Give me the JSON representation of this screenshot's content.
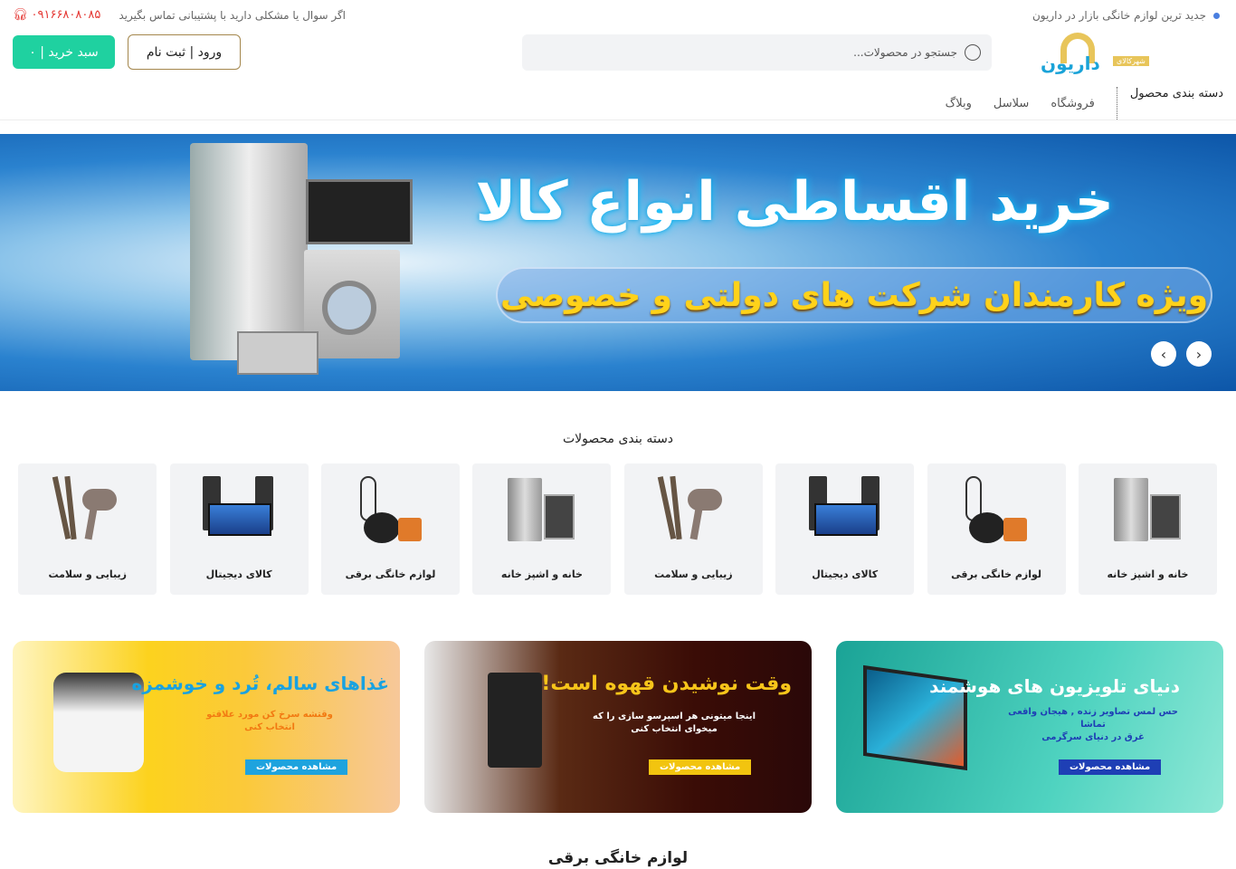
{
  "topbar": {
    "announcement": "جدید ترین لوازم خانگی بازار در داریون",
    "support_text": "اگر سوال یا مشکلی دارید با پشتیبانی تماس بگیرید",
    "phone": "۰۹۱۶۶۸۰۸۰۸۵",
    "dot_color": "#4a7fe0"
  },
  "header": {
    "logo_text": "داریون",
    "logo_tag": "شهرکالای",
    "search_placeholder": "جستجو در محصولات...",
    "login_label": "ورود | ثبت نام",
    "cart_label": "سبد خرید | ۰",
    "cart_color": "#1fd1a0"
  },
  "nav": {
    "items": [
      "دسته بندی محصول",
      "فروشگاه",
      "سلاسل",
      "وبلاگ"
    ]
  },
  "banner": {
    "title": "خرید اقساطی انواع کالا",
    "subtitle": "ویژه کارمندان شرکت های دولتی و خصوصی"
  },
  "categories": {
    "title": "دسته بندی محصولات",
    "items": [
      {
        "label": "خانه و اشپز خانه",
        "icon": "fridge"
      },
      {
        "label": "لوازم خانگی برقی",
        "icon": "vacuum"
      },
      {
        "label": "کالای دیجیتال",
        "icon": "tv-speakers"
      },
      {
        "label": "زیبایی و سلامت",
        "icon": "hair-dryer"
      },
      {
        "label": "خانه و اشپز خانه",
        "icon": "fridge"
      },
      {
        "label": "لوازم خانگی برقی",
        "icon": "vacuum"
      },
      {
        "label": "کالای دیجیتال",
        "icon": "tv-speakers"
      },
      {
        "label": "زیبایی و سلامت",
        "icon": "hair-dryer"
      }
    ]
  },
  "promos": [
    {
      "title": "دنیای تلویزیون های هوشمند",
      "line1": "حس لمس تصاویر زنده , هیجان واقعی تماشا",
      "line2": "غرق در دنیای سرگرمی",
      "button": "مشاهده محصولات"
    },
    {
      "title": "وقت نوشیدن قهوه است!",
      "line1": "اینجا میتونی هر اسپرسو سازی را که",
      "line2": "میخوای انتخاب کنی",
      "button": "مشاهده محصولات"
    },
    {
      "title": "غذاهای سالم، تُرد و خوشمزه",
      "line1": "وقتشه سرخ کن مورد علاقتو",
      "line2": "انتخاب کنی",
      "button": "مشاهده محصولات"
    }
  ],
  "section2": {
    "title": "لوازم خانگی برقی"
  }
}
